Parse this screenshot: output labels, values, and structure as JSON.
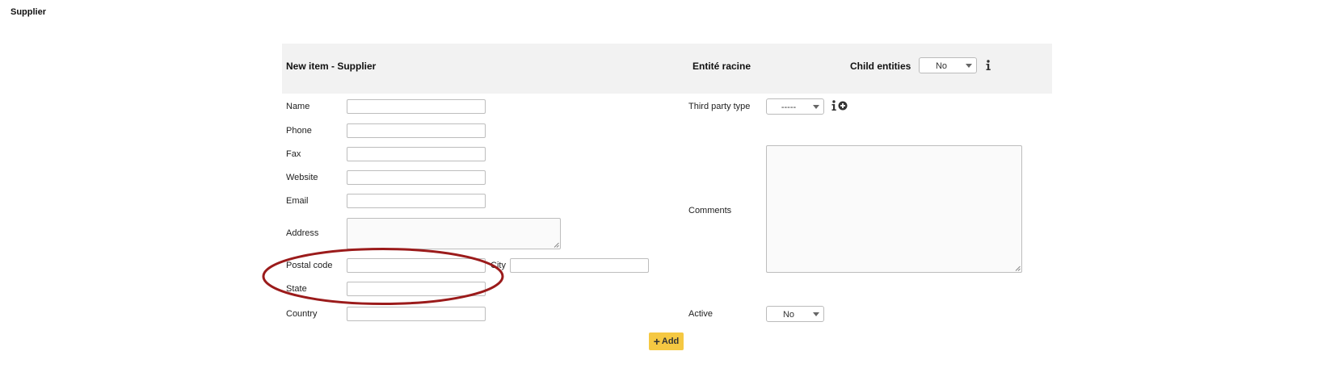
{
  "page": {
    "title": "Supplier"
  },
  "header": {
    "title": "New item - Supplier",
    "entity": "Entité racine",
    "child_entities_label": "Child entities",
    "child_entities_value": "No"
  },
  "left_fields": {
    "name_label": "Name",
    "phone_label": "Phone",
    "fax_label": "Fax",
    "website_label": "Website",
    "email_label": "Email",
    "address_label": "Address",
    "postal_code_label": "Postal code",
    "city_label": "City",
    "state_label": "State",
    "country_label": "Country"
  },
  "right_fields": {
    "third_party_type_label": "Third party type",
    "third_party_type_value": "-----",
    "comments_label": "Comments",
    "active_label": "Active",
    "active_value": "No"
  },
  "actions": {
    "add_label": "Add"
  },
  "icons": {
    "info": "info-icon",
    "plus_circle": "plus-circle-icon",
    "plus": "plus-icon",
    "caret": "chevron-down-icon"
  },
  "colors": {
    "header_band": "#f2f2f2",
    "add_button": "#f5c842",
    "annotation": "#9b1b1b"
  }
}
